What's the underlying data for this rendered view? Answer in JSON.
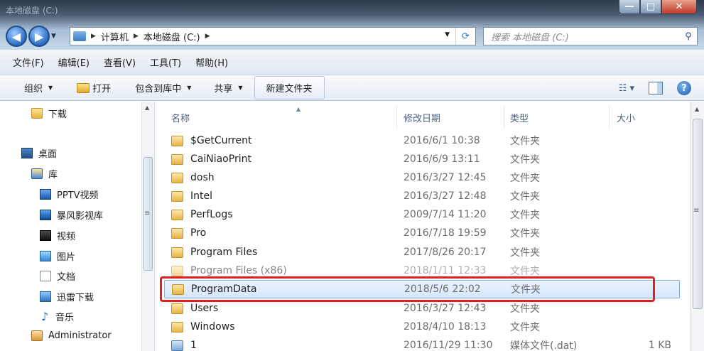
{
  "window": {
    "title": "本地磁盘 (C:)",
    "min_glyph": "—",
    "max_glyph": "□",
    "close_glyph": "✕"
  },
  "nav": {
    "back_glyph": "◀",
    "forward_glyph": "▶",
    "dropdown_glyph": "▼"
  },
  "address": {
    "crumb_sep": "▶",
    "crumbs": [
      "计算机",
      "本地磁盘 (C:)"
    ],
    "dropdown_glyph": "▼",
    "refresh_glyph": "⟳"
  },
  "search": {
    "placeholder": "搜索 本地磁盘 (C:)",
    "icon_glyph": "⚲"
  },
  "menu": [
    "文件(F)",
    "编辑(E)",
    "查看(V)",
    "工具(T)",
    "帮助(H)"
  ],
  "toolbar": {
    "organize": "组织",
    "open": "打开",
    "include_in_library": "包含到库中",
    "share": "共享",
    "new_folder": "新建文件夹",
    "dropdown_glyph": "▼",
    "view_glyph": "☷ ▾",
    "help_glyph": "?"
  },
  "sidebar": {
    "up_glyph": "▲",
    "grip_glyph": "≡",
    "music_glyph": "♪",
    "items": [
      {
        "label": "下载",
        "icon": "downloads-folder-icon"
      },
      {
        "label": "桌面",
        "icon": "desktop-icon"
      },
      {
        "label": "库",
        "icon": "libraries-icon"
      },
      {
        "label": "PPTV视频",
        "icon": "pptv-video-icon"
      },
      {
        "label": "暴风影视库",
        "icon": "storm-video-library-icon"
      },
      {
        "label": "视频",
        "icon": "videos-icon"
      },
      {
        "label": "图片",
        "icon": "pictures-icon"
      },
      {
        "label": "文档",
        "icon": "documents-icon"
      },
      {
        "label": "迅雷下载",
        "icon": "thunder-download-icon"
      },
      {
        "label": "音乐",
        "icon": "music-icon"
      },
      {
        "label": "Administrator",
        "icon": "user-folder-icon"
      }
    ]
  },
  "columns": {
    "name": "名称",
    "date": "修改日期",
    "type": "类型",
    "size": "大小",
    "sort_glyph": "▲"
  },
  "files": [
    {
      "name": "$GetCurrent",
      "date": "2016/6/1 10:38",
      "type": "文件夹",
      "size": ""
    },
    {
      "name": "CaiNiaoPrint",
      "date": "2016/6/9 13:11",
      "type": "文件夹",
      "size": ""
    },
    {
      "name": "dosh",
      "date": "2016/3/27 12:45",
      "type": "文件夹",
      "size": ""
    },
    {
      "name": "Intel",
      "date": "2016/3/27 12:48",
      "type": "文件夹",
      "size": ""
    },
    {
      "name": "PerfLogs",
      "date": "2009/7/14 11:20",
      "type": "文件夹",
      "size": ""
    },
    {
      "name": "Pro",
      "date": "2016/7/18 19:59",
      "type": "文件夹",
      "size": ""
    },
    {
      "name": "Program Files",
      "date": "2017/8/26 20:17",
      "type": "文件夹",
      "size": ""
    },
    {
      "name": "Program Files (x86)",
      "date": "2018/1/11 12:33",
      "type": "文件夹",
      "size": ""
    },
    {
      "name": "ProgramData",
      "date": "2018/5/6 22:02",
      "type": "文件夹",
      "size": ""
    },
    {
      "name": "Users",
      "date": "2016/3/27 12:43",
      "type": "文件夹",
      "size": ""
    },
    {
      "name": "Windows",
      "date": "2018/4/10 18:13",
      "type": "文件夹",
      "size": ""
    },
    {
      "name": "1",
      "date": "2016/11/29 11:30",
      "type": "媒体文件(.dat)",
      "size": "1 KB"
    }
  ],
  "selected_file": "ProgramData",
  "colors": {
    "highlight_border": "#e02020",
    "selection_fill": "#d5e7fb"
  }
}
